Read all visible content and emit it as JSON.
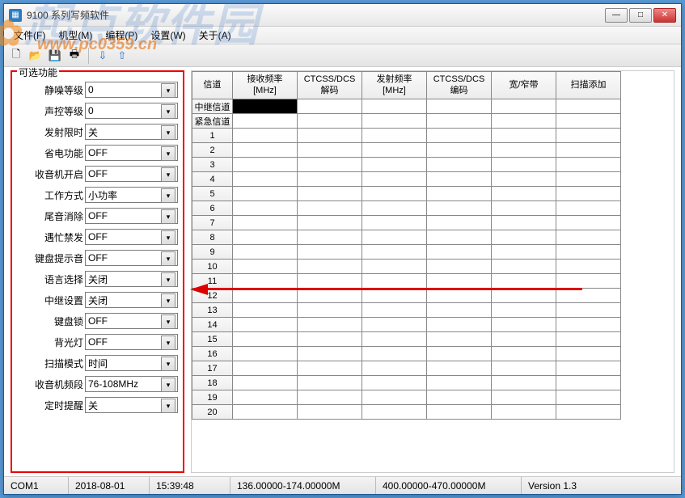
{
  "title": "9100 系列写频软件",
  "menu": [
    "文件(F)",
    "机型(M)",
    "编程(P)",
    "设置(W)",
    "关于(A)"
  ],
  "toolbar_icons": [
    "new-icon",
    "open-icon",
    "save-icon",
    "print-icon",
    "read-icon",
    "write-icon"
  ],
  "panel_title": "可选功能",
  "options": [
    {
      "label": "静噪等级",
      "value": "0"
    },
    {
      "label": "声控等级",
      "value": "0"
    },
    {
      "label": "发射限时",
      "value": "关"
    },
    {
      "label": "省电功能",
      "value": "OFF"
    },
    {
      "label": "收音机开启",
      "value": "OFF"
    },
    {
      "label": "工作方式",
      "value": "小功率"
    },
    {
      "label": "尾音消除",
      "value": "OFF"
    },
    {
      "label": "遇忙禁发",
      "value": "OFF"
    },
    {
      "label": "键盘提示音",
      "value": "OFF"
    },
    {
      "label": "语言选择",
      "value": "关闭"
    },
    {
      "label": "中继设置",
      "value": "关闭"
    },
    {
      "label": "键盘锁",
      "value": "OFF"
    },
    {
      "label": "背光灯",
      "value": "OFF"
    },
    {
      "label": "扫描模式",
      "value": "时间"
    },
    {
      "label": "收音机频段",
      "value": "76-108MHz"
    },
    {
      "label": "定时提醒",
      "value": "关"
    }
  ],
  "grid": {
    "columns": [
      "信道",
      "接收频率\n[MHz]",
      "CTCSS/DCS\n解码",
      "发射频率\n[MHz]",
      "CTCSS/DCS\n编码",
      "宽/窄带",
      "扫描添加"
    ],
    "fixed_rows": [
      "中继信道",
      "紧急信道"
    ],
    "row_count": 20
  },
  "status": {
    "port": "COM1",
    "date": "2018-08-01",
    "time": "15:39:48",
    "range1": "136.00000-174.00000M",
    "range2": "400.00000-470.00000M",
    "version": "Version 1.3"
  },
  "watermark": {
    "text": "起点软件园",
    "url": "www.pc0359.cn"
  }
}
